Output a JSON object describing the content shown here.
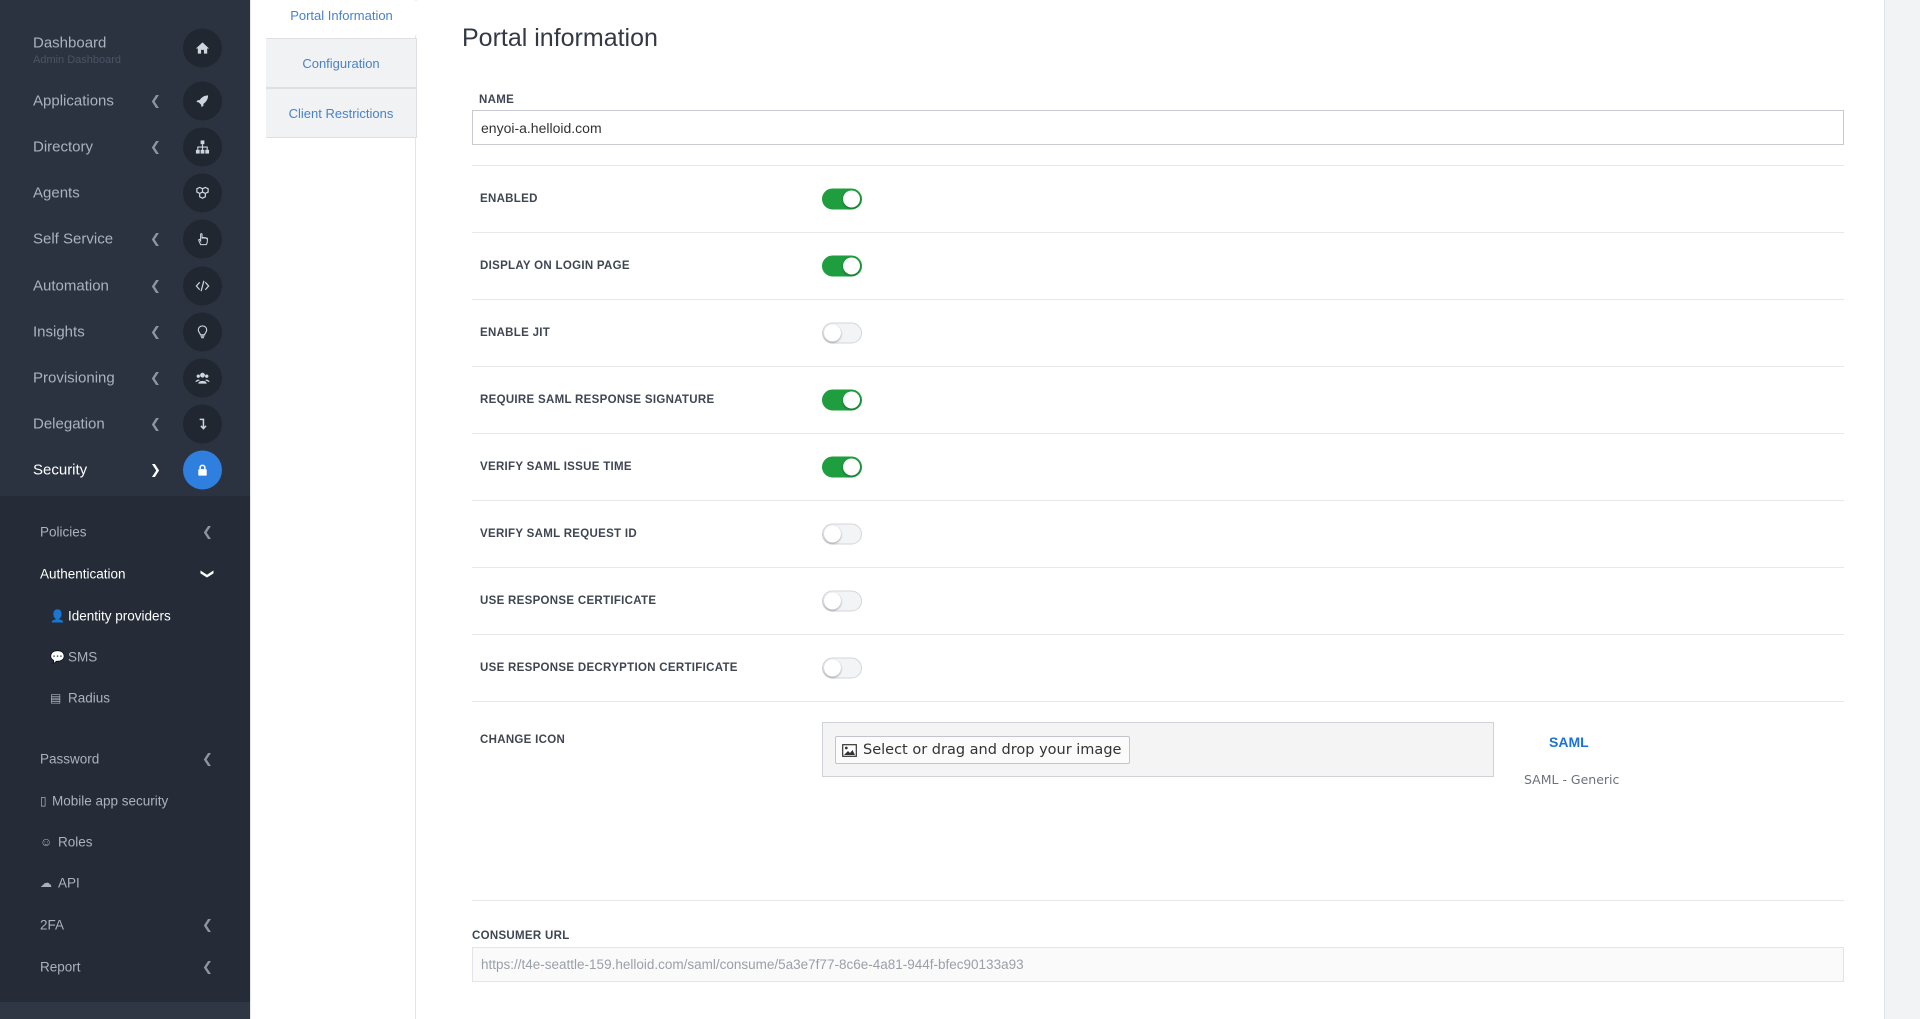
{
  "sidebar": {
    "items": [
      {
        "label": "Dashboard",
        "sublabel": "Admin Dashboard",
        "icon": "home-icon",
        "caret": false
      },
      {
        "label": "Applications",
        "icon": "rocket-icon",
        "caret": true
      },
      {
        "label": "Directory",
        "icon": "sitemap-icon",
        "caret": true
      },
      {
        "label": "Agents",
        "icon": "cubes-icon",
        "caret": false
      },
      {
        "label": "Self Service",
        "icon": "hand-pointer-icon",
        "caret": true
      },
      {
        "label": "Automation",
        "icon": "code-icon",
        "caret": true
      },
      {
        "label": "Insights",
        "icon": "lightbulb-icon",
        "caret": true
      },
      {
        "label": "Provisioning",
        "icon": "users-icon",
        "caret": true
      },
      {
        "label": "Delegation",
        "icon": "level-down-icon",
        "caret": true
      },
      {
        "label": "Security",
        "icon": "lock-icon",
        "caret": true,
        "active": true
      }
    ],
    "security_submenu": {
      "policies": "Policies",
      "authentication": "Authentication",
      "authentication_children": [
        {
          "label": "Identity providers",
          "icon": "user-plus-icon",
          "active": true
        },
        {
          "label": "SMS",
          "icon": "comment-icon"
        },
        {
          "label": "Radius",
          "icon": "server-icon"
        }
      ],
      "password": "Password",
      "mobile_app_security": "Mobile app security",
      "roles": "Roles",
      "api": "API",
      "twofa": "2FA",
      "report": "Report"
    }
  },
  "tabs": [
    {
      "label": "Portal Information",
      "active": true
    },
    {
      "label": "Configuration",
      "active": false
    },
    {
      "label": "Client Restrictions",
      "active": false
    }
  ],
  "main": {
    "title": "Portal information",
    "name_label": "NAME",
    "name_value": "enyoi-a.helloid.com",
    "settings": [
      {
        "label": "ENABLED",
        "on": true
      },
      {
        "label": "DISPLAY ON LOGIN PAGE",
        "on": true
      },
      {
        "label": "ENABLE JIT",
        "on": false
      },
      {
        "label": "REQUIRE SAML RESPONSE SIGNATURE",
        "on": true
      },
      {
        "label": "VERIFY SAML ISSUE TIME",
        "on": true
      },
      {
        "label": "VERIFY SAML REQUEST ID",
        "on": false
      },
      {
        "label": "USE RESPONSE CERTIFICATE",
        "on": false
      },
      {
        "label": "USE RESPONSE DECRYPTION CERTIFICATE",
        "on": false
      }
    ],
    "change_icon_label": "CHANGE ICON",
    "image_button_label": "Select or drag and drop your image",
    "saml_logo_text": "SAML",
    "saml_caption": "SAML - Generic",
    "consumer_url_label": "CONSUMER URL",
    "consumer_url_value": "https://t4e-seattle-159.helloid.com/saml/consume/5a3e7f77-8c6e-4a81-944f-bfec90133a93"
  },
  "colors": {
    "sidebar_bg": "#2b3340",
    "accent": "#2f7fde",
    "toggle_on": "#1e9e3e",
    "link": "#4a82c8"
  }
}
